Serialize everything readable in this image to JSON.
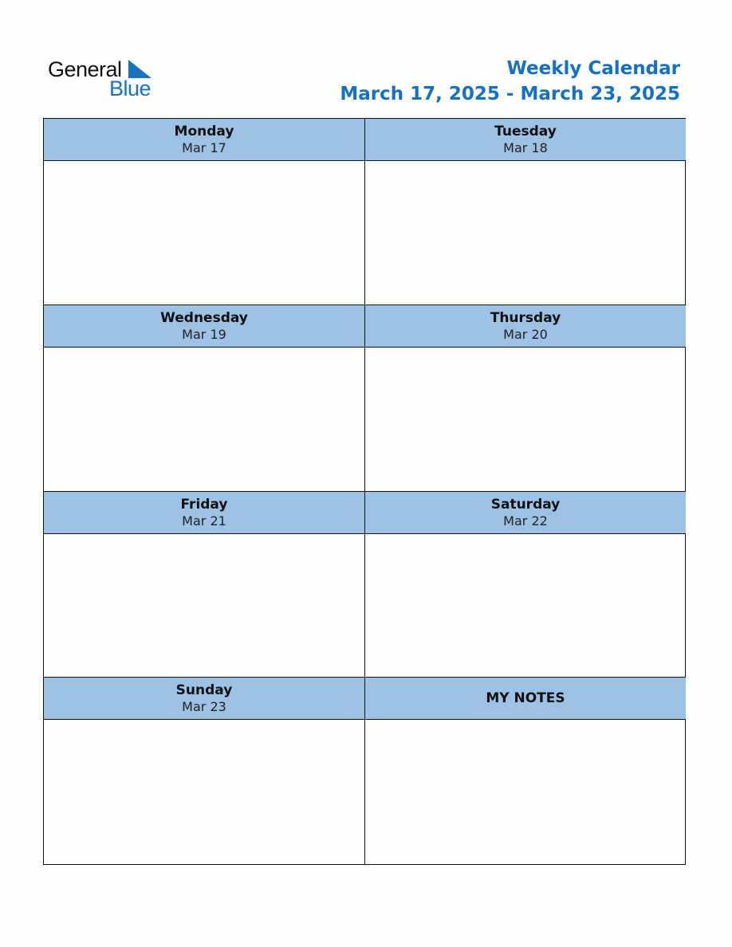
{
  "logo": {
    "word1": "General",
    "word2": "Blue"
  },
  "title": {
    "line1": "Weekly Calendar",
    "line2": "March 17, 2025 - March 23, 2025"
  },
  "days": [
    {
      "day": "Monday",
      "date": "Mar 17"
    },
    {
      "day": "Tuesday",
      "date": "Mar 18"
    },
    {
      "day": "Wednesday",
      "date": "Mar 19"
    },
    {
      "day": "Thursday",
      "date": "Mar 20"
    },
    {
      "day": "Friday",
      "date": "Mar 21"
    },
    {
      "day": "Saturday",
      "date": "Mar 22"
    },
    {
      "day": "Sunday",
      "date": "Mar 23"
    }
  ],
  "notes": {
    "label": "MY NOTES"
  },
  "colors": {
    "accent": "#1570c0",
    "header_fill": "#9dc2e5"
  }
}
